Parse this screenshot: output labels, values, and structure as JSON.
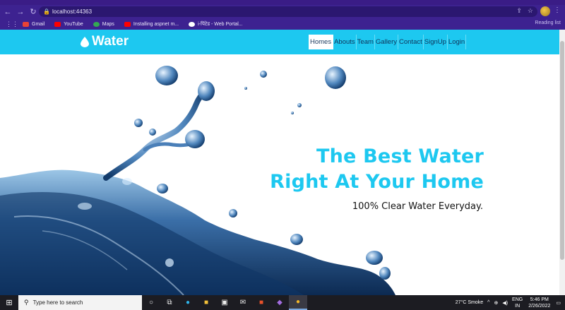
{
  "browser": {
    "url": "localhost:44363",
    "bookmarks": [
      {
        "label": "Gmail",
        "color": "#e94235"
      },
      {
        "label": "YouTube",
        "color": "#ff0000"
      },
      {
        "label": "Maps",
        "color": "#34a853"
      },
      {
        "label": "Installing aspnet m...",
        "color": "#ff0000"
      },
      {
        "label": "i-पिंटेड - Web Portal...",
        "color": "#ffffff"
      }
    ],
    "reading_list": "Reading list"
  },
  "site": {
    "brand": "Water",
    "nav": [
      "Homes",
      "Abouts",
      "Team",
      "Gallery",
      "Contact",
      "SignUp",
      "Login"
    ],
    "active_nav": "Homes",
    "accent": "#1dc8f0"
  },
  "hero": {
    "headline_line1": "The Best Water",
    "headline_line2": "Right At Your Home",
    "subtitle": "100% Clear Water Everyday."
  },
  "taskbar": {
    "search_placeholder": "Type here to search",
    "weather": "27°C  Smoke",
    "lang_top": "ENG",
    "lang_bottom": "IN",
    "time": "5:46 PM",
    "date": "2/26/2022"
  }
}
